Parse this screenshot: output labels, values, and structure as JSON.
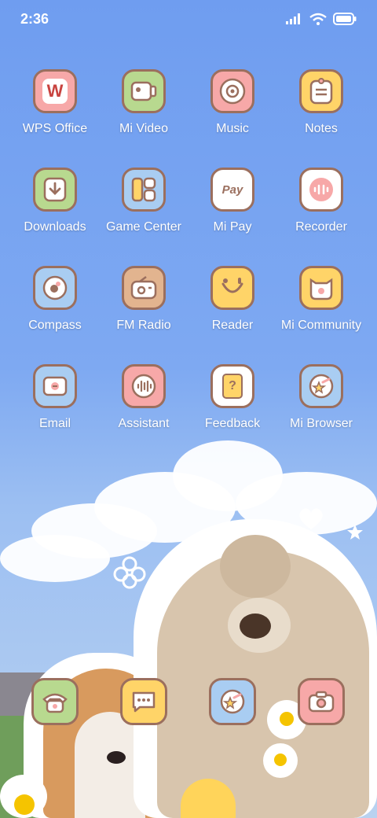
{
  "status": {
    "time": "2:36"
  },
  "colors": {
    "pink": "#f7a8a8",
    "green": "#b8d98f",
    "yellow": "#ffd468",
    "blue": "#a9cdf2",
    "tan": "#e2b48f",
    "white": "#ffffff",
    "outline": "#9b6f5e"
  },
  "apps": [
    {
      "label": "WPS Office",
      "icon": "wps-icon",
      "bg": "pink"
    },
    {
      "label": "Mi Video",
      "icon": "video-icon",
      "bg": "green"
    },
    {
      "label": "Music",
      "icon": "music-icon",
      "bg": "pink"
    },
    {
      "label": "Notes",
      "icon": "notes-icon",
      "bg": "yellow"
    },
    {
      "label": "Downloads",
      "icon": "download-icon",
      "bg": "green"
    },
    {
      "label": "Game Center",
      "icon": "game-icon",
      "bg": "blue"
    },
    {
      "label": "Mi Pay",
      "icon": "pay-icon",
      "bg": "white"
    },
    {
      "label": "Recorder",
      "icon": "recorder-icon",
      "bg": "white"
    },
    {
      "label": "Compass",
      "icon": "compass-icon",
      "bg": "blue"
    },
    {
      "label": "FM Radio",
      "icon": "radio-icon",
      "bg": "tan"
    },
    {
      "label": "Reader",
      "icon": "reader-icon",
      "bg": "yellow"
    },
    {
      "label": "Mi Community",
      "icon": "community-icon",
      "bg": "yellow"
    },
    {
      "label": "Email",
      "icon": "email-icon",
      "bg": "blue"
    },
    {
      "label": "Assistant",
      "icon": "assistant-icon",
      "bg": "pink"
    },
    {
      "label": "Feedback",
      "icon": "feedback-icon",
      "bg": "white"
    },
    {
      "label": "Mi Browser",
      "icon": "browser-icon",
      "bg": "blue"
    }
  ],
  "dock": [
    {
      "icon": "phone-icon",
      "bg": "green"
    },
    {
      "icon": "messages-icon",
      "bg": "yellow"
    },
    {
      "icon": "browser-icon",
      "bg": "blue"
    },
    {
      "icon": "camera-icon",
      "bg": "pink"
    }
  ],
  "glyphs": {
    "wps": "W",
    "pay": "Pay",
    "feedback": "?"
  }
}
